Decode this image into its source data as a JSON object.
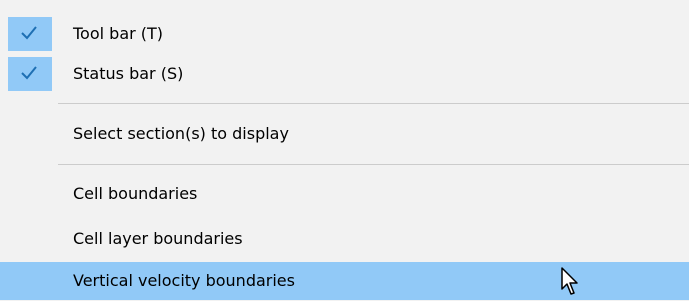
{
  "menu": {
    "items": [
      {
        "label": "Tool bar (T)",
        "checked": true
      },
      {
        "label": "Status bar (S)",
        "checked": true
      },
      {
        "label": "Select section(s) to display",
        "checked": false
      },
      {
        "label": "Cell boundaries",
        "checked": false
      },
      {
        "label": "Cell layer boundaries",
        "checked": false
      },
      {
        "label": "Vertical velocity boundaries",
        "checked": false,
        "highlighted": true
      }
    ]
  },
  "colors": {
    "background": "#f2f2f2",
    "highlight": "#91c9f7",
    "check_mark": "#1e6fb3",
    "separator": "#cccccc"
  }
}
